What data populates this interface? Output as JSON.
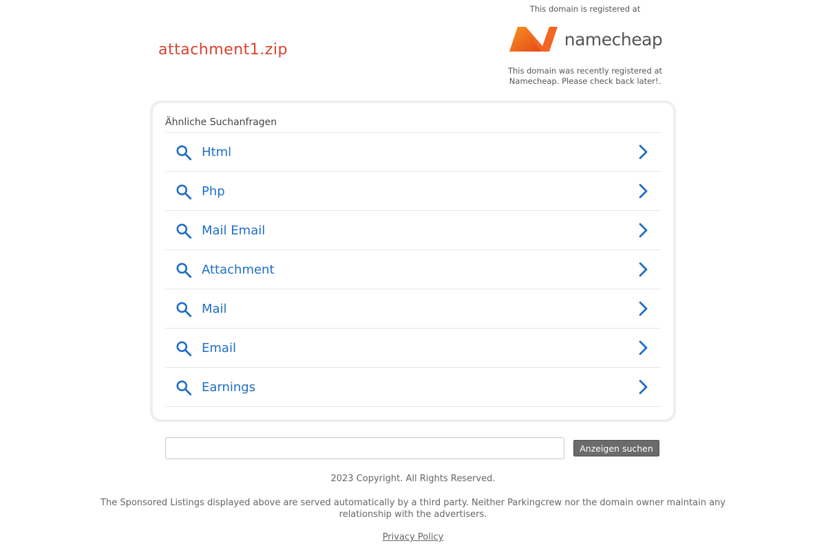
{
  "domain": "attachment1.zip",
  "registrar": {
    "top_text": "This domain is registered at",
    "logo_text": "namecheap",
    "bottom_text": "This domain was recently registered at Namecheap. Please check back later!.",
    "brand_color": "#f26522"
  },
  "related": {
    "heading": "Ähnliche Suchanfragen",
    "items": [
      {
        "label": "Html"
      },
      {
        "label": "Php"
      },
      {
        "label": "Mail Email"
      },
      {
        "label": "Attachment"
      },
      {
        "label": "Mail"
      },
      {
        "label": "Email"
      },
      {
        "label": "Earnings"
      }
    ]
  },
  "search": {
    "value": "",
    "button_label": "Anzeigen suchen"
  },
  "footer": {
    "copyright": "2023 Copyright. All Rights Reserved.",
    "disclaimer": "The Sponsored Listings displayed above are served automatically by a third party. Neither Parkingcrew nor the domain owner maintain any relationship with the advertisers.",
    "privacy_label": "Privacy Policy"
  },
  "colors": {
    "title": "#d9432e",
    "link": "#1e6ec6"
  }
}
